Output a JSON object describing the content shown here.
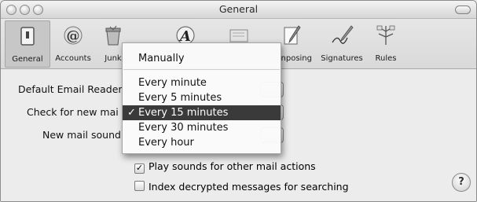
{
  "window": {
    "title": "General"
  },
  "toolbar": {
    "items": [
      {
        "label": "General",
        "icon": "general-switch-icon"
      },
      {
        "label": "Accounts",
        "icon": "at-sign-icon"
      },
      {
        "label": "Junk",
        "icon": "junk-mail-icon"
      },
      {
        "label": "",
        "icon": "fonts-icon"
      },
      {
        "label": "",
        "icon": "viewing-icon"
      },
      {
        "label": "nposing",
        "icon": "composing-pencil-icon"
      },
      {
        "label": "Signatures",
        "icon": "signature-pen-icon"
      },
      {
        "label": "Rules",
        "icon": "rules-icon"
      }
    ]
  },
  "settings": {
    "default_email_reader_label": "Default Email Reader",
    "check_mail_label": "Check for new mai",
    "new_mail_sound_label": "New mail sound",
    "play_sounds_label": "Play sounds for other mail actions",
    "play_sounds_checked": true,
    "index_decrypted_label": "Index decrypted messages for searching",
    "index_decrypted_checked": false,
    "help_label": "?"
  },
  "menu": {
    "items": [
      "Manually",
      "Every minute",
      "Every 5 minutes",
      "Every 15 minutes",
      "Every 30 minutes",
      "Every hour"
    ],
    "selected": "Every 15 minutes",
    "checkmark": "✓"
  }
}
